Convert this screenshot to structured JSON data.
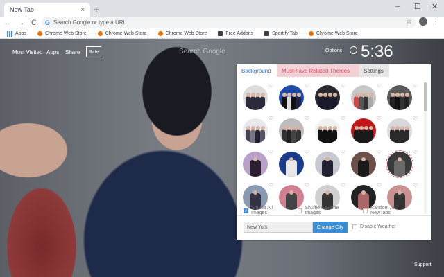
{
  "browser": {
    "tab_title": "New Tab",
    "tab_close": "×",
    "new_tab": "+",
    "window_controls": [
      "–",
      "☐",
      "✕"
    ],
    "nav": [
      "←",
      "→",
      "C"
    ],
    "omnibox_placeholder": "Search Google or type a URL",
    "star": "☆",
    "menu": "⋮"
  },
  "bookmarks": [
    {
      "label": "Apps",
      "icon": "apps-grid-icon",
      "color": "#4285f4"
    },
    {
      "label": "Chrome Web Store",
      "icon": "chrome-store-icon",
      "color": "#e8710a"
    },
    {
      "label": "Chrome Web Store",
      "icon": "chrome-store-icon",
      "color": "#e8710a"
    },
    {
      "label": "Chrome Web Store",
      "icon": "chrome-store-icon",
      "color": "#e8710a"
    },
    {
      "label": "Free Addons",
      "icon": "addons-icon",
      "color": "#3c4043"
    },
    {
      "label": "Sportify Tab",
      "icon": "sportify-icon",
      "color": "#3c4043"
    },
    {
      "label": "Chrome Web Store",
      "icon": "chrome-store-icon",
      "color": "#e8710a"
    }
  ],
  "newtab": {
    "links": [
      "Most Visited",
      "Apps",
      "Share"
    ],
    "rate": "Rate",
    "search_placeholder": "Search Google",
    "options": "Options",
    "clock": "5:36",
    "support": "Support"
  },
  "panel": {
    "tabs": [
      "Background",
      "Must-have Related Themes",
      "Settings"
    ],
    "active_tab": "Background",
    "heart": "♡",
    "thumbnails": [
      {
        "bg": "#dcdcdc",
        "figs": [
          "#2a2a3a",
          "#2a2a3a",
          "#2a2a3a",
          "#2a2a3a"
        ]
      },
      {
        "bg": "#1e4aa8",
        "figs": [
          "#111111",
          "#dddddd",
          "#111111",
          "#222244"
        ]
      },
      {
        "bg": "#2a2a30",
        "figs": [
          "#1a1a2a",
          "#1a1a2a",
          "#1a1a2a",
          "#1a1a2a"
        ]
      },
      {
        "bg": "#c8c8c8",
        "figs": [
          "#c84a4a",
          "#555555",
          "#333333",
          "#aaaaaa"
        ]
      },
      {
        "bg": "#5a5a5a",
        "figs": [
          "#222222",
          "#111111",
          "#333333",
          "#222222"
        ]
      },
      {
        "bg": "#e8e8ee",
        "figs": [
          "#444455",
          "#777788",
          "#222233",
          "#555566"
        ]
      },
      {
        "bg": "#bcbcbc",
        "figs": [
          "#333333",
          "#222222",
          "#444444",
          "#333333"
        ]
      },
      {
        "bg": "#f0f0f0",
        "figs": [
          "#111111",
          "#111111",
          "#111111",
          "#111111"
        ]
      },
      {
        "bg": "#c01818",
        "figs": [
          "#1a1a1a",
          "#1a1a1a",
          "#1a1a1a",
          "#1a1a1a"
        ]
      },
      {
        "bg": "#d8d8dc",
        "figs": [
          "#2a2a2a",
          "#2a2a2a",
          "#2a2a2a",
          "#2a2a2a"
        ]
      },
      {
        "bg": "#b8a0c8",
        "figs": [
          "#2a2030"
        ]
      },
      {
        "bg": "#1a3a8a",
        "figs": [
          "#e8e8e8"
        ]
      },
      {
        "bg": "#c8c8d0",
        "figs": [
          "#222233"
        ]
      },
      {
        "bg": "#6a5048",
        "figs": [
          "#1a1a1a"
        ]
      },
      {
        "bg": "#3a3a3a",
        "figs": [
          "#6a6a6a"
        ]
      },
      {
        "bg": "#8a9ab0",
        "figs": [
          "#333344"
        ]
      },
      {
        "bg": "#d08090",
        "figs": [
          "#444444"
        ]
      },
      {
        "bg": "#d0d0d0",
        "figs": [
          "#333333"
        ]
      },
      {
        "bg": "#222222",
        "figs": [
          "#aa6666"
        ]
      },
      {
        "bg": "#c89090",
        "figs": [
          "#333333"
        ]
      }
    ],
    "options": [
      {
        "label": "Shuffle All Images",
        "checked": true
      },
      {
        "label": "Shuffle Favorite Images",
        "checked": false
      },
      {
        "label": "Random All NewTabs",
        "checked": false
      }
    ],
    "city_value": "New York",
    "city_button": "Change City",
    "weather_label": "Disable Weather"
  }
}
